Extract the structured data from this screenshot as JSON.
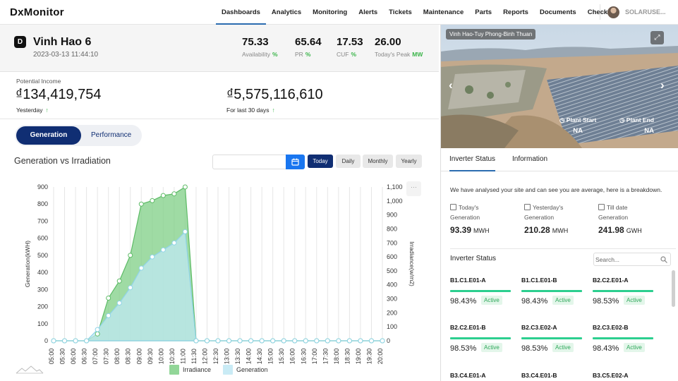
{
  "app": {
    "logo": "DxMonitor",
    "user": "SOLARUSE..."
  },
  "nav": [
    "Dashboards",
    "Analytics",
    "Monitoring",
    "Alerts",
    "Tickets",
    "Maintenance",
    "Parts",
    "Reports",
    "Documents",
    "Checklist"
  ],
  "plant": {
    "name": "Vinh Hao 6",
    "timestamp": "2023-03-13 11:44:10",
    "icon_letter": "D",
    "kpis": [
      {
        "value": "75.33",
        "label": "Availability",
        "unit": "%"
      },
      {
        "value": "65.64",
        "label": "PR",
        "unit": "%"
      },
      {
        "value": "17.53",
        "label": "CUF",
        "unit": "%"
      },
      {
        "value": "26.00",
        "label": "Today's Peak",
        "unit": "MW"
      }
    ]
  },
  "income": {
    "label": "Potential Income",
    "yesterday": {
      "value": "₫134,419,754",
      "sub": "Yesterday",
      "arrow": "↑"
    },
    "last30": {
      "value": "₫5,575,116,610",
      "sub": "For last 30 days",
      "arrow": "↑"
    }
  },
  "segment": {
    "active": "Generation",
    "inactive": "Performance"
  },
  "chart_section": {
    "title": "Generation vs Irradiation",
    "periods": [
      "Today",
      "Daily",
      "Monthly",
      "Yearly"
    ],
    "menu": "···"
  },
  "chart_data": {
    "type": "area",
    "x": [
      "05:00",
      "05:30",
      "06:00",
      "06:30",
      "07:00",
      "07:30",
      "08:00",
      "08:30",
      "09:00",
      "09:30",
      "10:00",
      "10:30",
      "11:00",
      "11:30",
      "12:00",
      "12:30",
      "13:00",
      "13:30",
      "14:00",
      "14:30",
      "15:00",
      "15:30",
      "16:00",
      "16:30",
      "17:00",
      "17:30",
      "18:00",
      "18:30",
      "19:00",
      "19:30",
      "20:00"
    ],
    "ylabel": "Generation(kWH)",
    "y2label": "Irradiance(w/m2)",
    "ylim": [
      0,
      900
    ],
    "y2lim": [
      0,
      1100
    ],
    "yticks": [
      "0",
      "100",
      "200",
      "300",
      "400",
      "500",
      "600",
      "700",
      "800",
      "900"
    ],
    "y2ticks": [
      "0",
      "100",
      "200",
      "300",
      "400",
      "500",
      "600",
      "700",
      "800",
      "900",
      "1,000",
      "1,100"
    ],
    "series": [
      {
        "name": "Irradiance",
        "color": "#7fcf86",
        "values": [
          0,
          0,
          0,
          0,
          40,
          250,
          350,
          500,
          800,
          820,
          850,
          860,
          900,
          0,
          0,
          0,
          0,
          0,
          0,
          0,
          0,
          0,
          0,
          0,
          0,
          0,
          0,
          0,
          0,
          0,
          0
        ]
      },
      {
        "name": "Generation",
        "color": "#bfe8f3",
        "values": [
          0,
          0,
          0,
          0,
          80,
          180,
          270,
          380,
          520,
          600,
          650,
          700,
          780,
          0,
          0,
          0,
          0,
          0,
          0,
          0,
          0,
          0,
          0,
          0,
          0,
          0,
          0,
          0,
          0,
          0,
          0
        ]
      }
    ]
  },
  "photo": {
    "location": "Vinh Hao-Tuy Phong-Binh Thuan",
    "plant_start_label": "Plant Start",
    "plant_start_value": "NA",
    "plant_end_label": "Plant End",
    "plant_end_value": "NA"
  },
  "right_tabs": [
    "Inverter Status",
    "Information"
  ],
  "analysis": {
    "text": "We have analysed your site and can see you are average, here is a breakdown.",
    "stats": [
      {
        "h1": "Today's",
        "h2": "Generation",
        "value": "93.39",
        "unit": "MWH"
      },
      {
        "h1": "Yesterday's",
        "h2": "Generation",
        "value": "210.28",
        "unit": "MWH"
      },
      {
        "h1": "Till date",
        "h2": "Generation",
        "value": "241.98",
        "unit": "GWH"
      }
    ]
  },
  "inverters": {
    "title": "Inverter Status",
    "search_placeholder": "Search...",
    "items": [
      {
        "name": "B1.C1.E01-A",
        "pct": "98.43%",
        "status": "Active"
      },
      {
        "name": "B1.C1.E01-B",
        "pct": "98.43%",
        "status": "Active"
      },
      {
        "name": "B2.C2.E01-A",
        "pct": "98.53%",
        "status": "Active"
      },
      {
        "name": "B2.C2.E01-B",
        "pct": "98.53%",
        "status": "Active"
      },
      {
        "name": "B2.C3.E02-A",
        "pct": "98.53%",
        "status": "Active"
      },
      {
        "name": "B2.C3.E02-B",
        "pct": "98.43%",
        "status": "Active"
      },
      {
        "name": "B3.C4.E01-A",
        "pct": "",
        "status": ""
      },
      {
        "name": "B3.C4.E01-B",
        "pct": "",
        "status": ""
      },
      {
        "name": "B3.C5.E02-A",
        "pct": "",
        "status": ""
      }
    ]
  }
}
